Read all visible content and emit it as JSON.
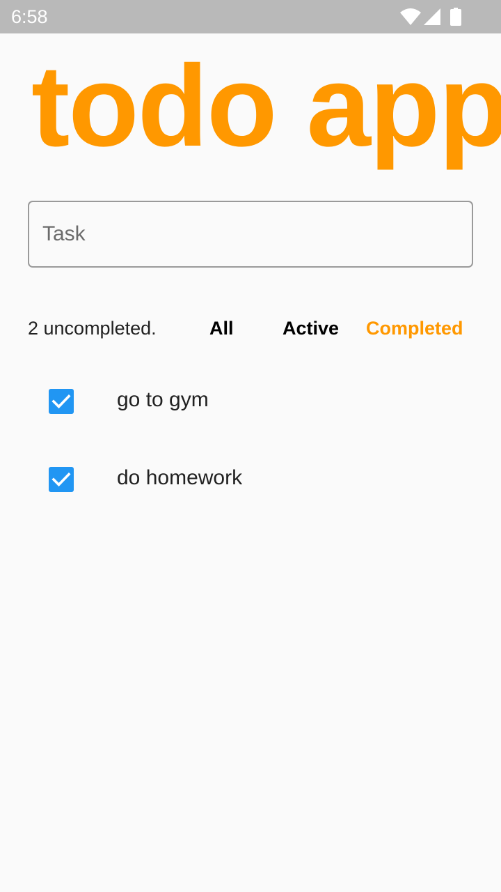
{
  "status_bar": {
    "time": "6:58",
    "icons": [
      "wifi-icon",
      "signal-icon",
      "battery-icon"
    ]
  },
  "app": {
    "title": "todo app",
    "accent_color": "#ff9800",
    "checkbox_color": "#2196f3"
  },
  "input": {
    "placeholder": "Task",
    "value": ""
  },
  "filter": {
    "count_text": "2 uncompleted.",
    "options": [
      "All",
      "Active",
      "Completed"
    ],
    "selected": "Completed"
  },
  "todos": [
    {
      "label": "go to gym",
      "checked": true
    },
    {
      "label": "do homework",
      "checked": true
    }
  ]
}
